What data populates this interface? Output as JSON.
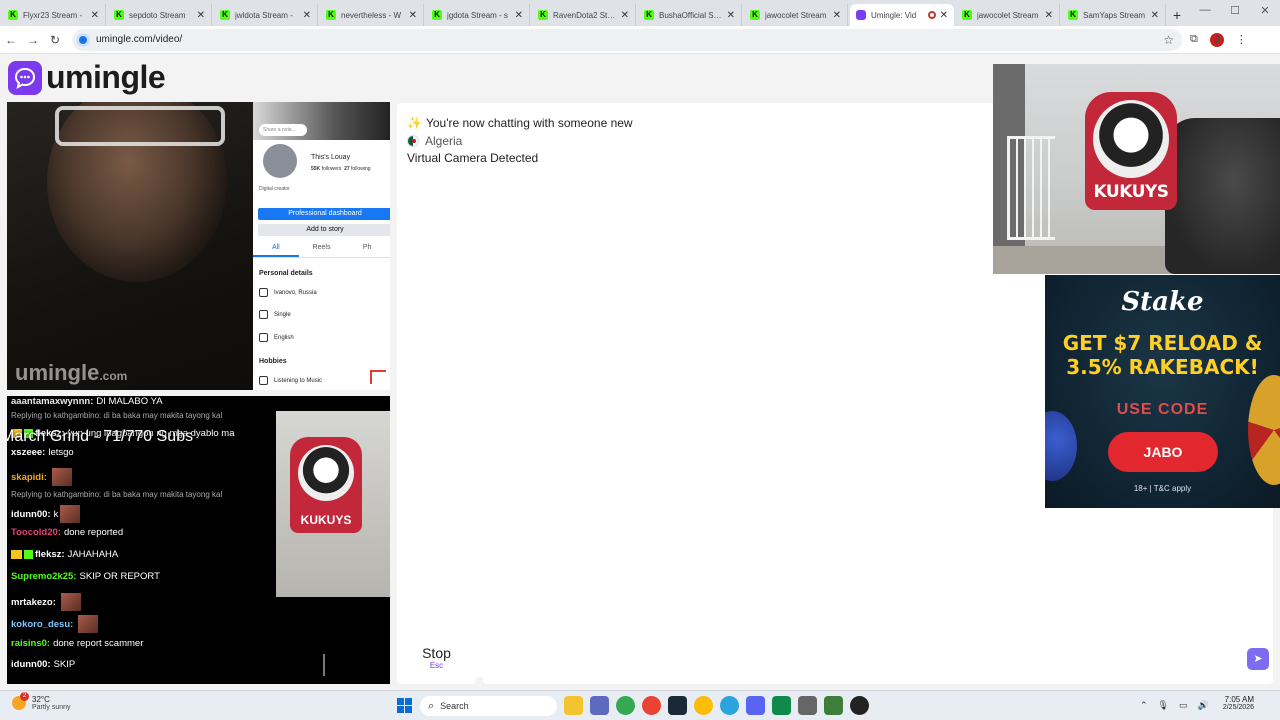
{
  "browser": {
    "tabs": [
      {
        "title": "Flyxr23 Stream - ",
        "icon": "kick-icon",
        "active": false
      },
      {
        "title": "sepdoto Stream",
        "icon": "kick-icon",
        "active": false
      },
      {
        "title": "jwldota Stream -",
        "icon": "kick-icon",
        "active": false
      },
      {
        "title": "nevertheless - W",
        "icon": "kick-icon",
        "active": false
      },
      {
        "title": "jgdota Stream - s",
        "icon": "kick-icon",
        "active": false
      },
      {
        "title": "RavenDota2 Strea",
        "icon": "kick-icon",
        "active": false
      },
      {
        "title": "BushaOfficial Stre",
        "icon": "kick-icon",
        "active": false
      },
      {
        "title": "jawocolet Stream",
        "icon": "kick-icon",
        "active": false
      },
      {
        "title": "Umingle: Vid",
        "icon": "umingle-icon",
        "active": true
      },
      {
        "title": "jawocolet Stream",
        "icon": "kick-icon",
        "active": false
      },
      {
        "title": "SamYaps Stream",
        "icon": "kick-icon",
        "active": false
      }
    ],
    "url": "umingle.com/video/",
    "profile_initial": "J"
  },
  "logo": {
    "text": "umingle",
    "color": "#7c3aed"
  },
  "self_video": {
    "watermark": "umingle",
    "watermark_suffix": ".com",
    "profile": {
      "note": "Share a note...",
      "name": "This's Louay",
      "followers_count": "55K",
      "followers_label": "followers",
      "following_count": "27",
      "following_label": "following",
      "role": "Digital creator",
      "dashboard_btn": "Professional dashboard",
      "story_btn": "Add to story",
      "tabs": [
        "All",
        "Reels",
        "Ph"
      ],
      "section_personal": "Personal details",
      "location": "Ivanovo, Russia",
      "relationship": "Single",
      "language": "English",
      "section_hobbies": "Hobbies",
      "hobby": "Listening to Music"
    }
  },
  "chat": {
    "sparkle_icon": "✨",
    "line1": "You're now chatting with someone new",
    "country": "Algeria",
    "line3": "Virtual Camera Detected"
  },
  "stranger_cam": {
    "logo_text": "KUKUYS"
  },
  "ad": {
    "brand": "Stake",
    "headline": "GET $7 RELOAD & 3.5% RAKEBACK!",
    "code_label": "USE CODE",
    "code": "JABO",
    "fine_print": "18+ | T&C apply"
  },
  "stream": {
    "title": "March Grind - 71/770 Subs",
    "cam_logo_text": "KUKUYS",
    "chat": [
      {
        "user": "aaantamaxwynnn:",
        "text": "DI MALABO YA",
        "color": "#e8e8e8",
        "reply": ""
      },
      {
        "user": "",
        "text": "",
        "color": "#aaaaaa",
        "reply": "Replying to kathgambino: di ba baka may makita tayong kal"
      },
      {
        "user": "fleksz:",
        "text": "yun ung ipagbangon ng mga dyablo ma",
        "color": "#ffffff",
        "reply": ""
      },
      {
        "user": "xszeee:",
        "text": "letsgo",
        "color": "#ffffff",
        "reply": ""
      },
      {
        "user": "skapidi:",
        "text": "",
        "color": "#f5a623",
        "reply": ""
      },
      {
        "user": "",
        "text": "",
        "color": "#aaaaaa",
        "reply": "Replying to kathgambino: di ba baka may makita tayong kal"
      },
      {
        "user": "idunn00:",
        "text": "k",
        "color": "#ffffff",
        "reply": ""
      },
      {
        "user": "Toocold20:",
        "text": "done reported",
        "color": "#e0407b",
        "reply": ""
      },
      {
        "user": "fleksz:",
        "text": "JAHAHAHA",
        "color": "#ffffff",
        "reply": ""
      },
      {
        "user": "Supremo2k25:",
        "text": "SKIP OR REPORT",
        "color": "#53fc18",
        "reply": ""
      },
      {
        "user": "mrtakezo:",
        "text": "",
        "color": "#ffffff",
        "reply": ""
      },
      {
        "user": "kokoro_desu:",
        "text": "",
        "color": "#7ec8ff",
        "reply": ""
      },
      {
        "user": "raisins0:",
        "text": "done report scammer",
        "color": "#53fc18",
        "reply": ""
      },
      {
        "user": "idunn00:",
        "text": "SKIP",
        "color": "#ffffff",
        "reply": ""
      }
    ]
  },
  "controls": {
    "stop_label": "Stop",
    "stop_key": "Esc",
    "send_icon": "send-icon"
  },
  "taskbar": {
    "temp": "32°C",
    "weather": "Partly sunny",
    "weather_badge": "2",
    "search": "Search",
    "time": "7:05 AM",
    "date": "2/25/2026"
  }
}
